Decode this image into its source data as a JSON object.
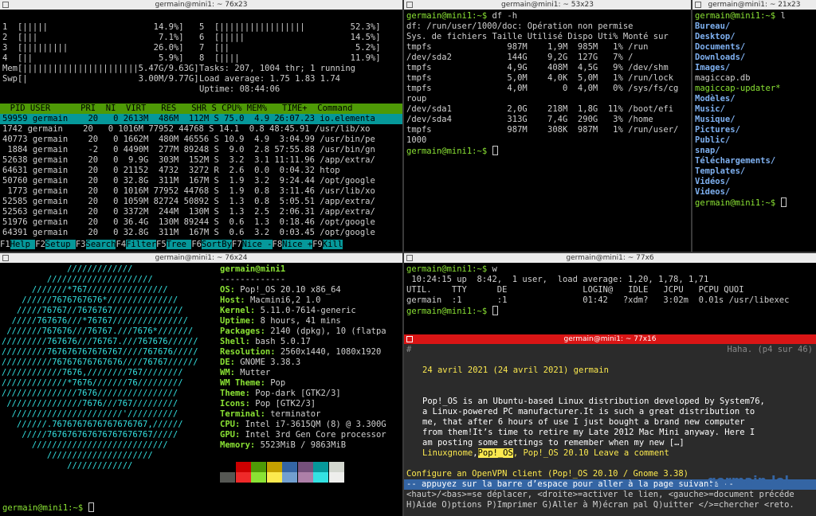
{
  "htop": {
    "title": "germain@mini1: ~ 76x23",
    "cpu": [
      "1  [|||||                     14.9%]",
      "2  [|||                        7.1%]",
      "3  [|||||||||                 26.0%]",
      "4  [||                         5.9%]"
    ],
    "cpu2": [
      "5  [|||||||||||||||||         52.3%]",
      "6  [|||||                     14.5%]",
      "7  [||                         5.2%]",
      "8  [||||                      11.9%]"
    ],
    "mem": "Mem[|||||||||||||||||||||||5.47G/9.63G]",
    "swp": "Swp[|                      3.00M/9.77G]",
    "tasks": "Tasks: 207, 1004 thr; 1 running",
    "load": "Load average: 1.75 1.83 1.74",
    "uptime": "Uptime: 08:44:06",
    "header": "  PID USER      PRI  NI  VIRT   RES   SHR S CPU% MEM%   TIME+  Command",
    "rows": [
      "59959 germain    20   0 2613M  486M  112M S 75.0  4.9 26:07.23 io.elementa",
      "1742 germain    20   0 1016M 77952 44768 S 14.1  0.8 48:45.91 /usr/lib/xo",
      "40773 germain    20   0 1662M  480M 46556 S 10.9  4.9  3:04.99 /usr/bin/pe",
      " 1884 germain    -2   0 4490M  277M 89248 S  9.0  2.8 57:55.88 /usr/bin/gn",
      "52638 germain    20   0  9.9G  303M  152M S  3.2  3.1 11:11.96 /app/extra/",
      "64631 germain    20   0 21152  4732  3272 R  2.6  0.0  0:04.32 htop",
      "50760 germain    20   0 32.8G  311M  167M S  1.9  3.2  9:24.44 /opt/google",
      " 1773 germain    20   0 1016M 77952 44768 S  1.9  0.8  3:11.46 /usr/lib/xo",
      "52585 germain    20   0 1059M 82724 50892 S  1.3  0.8  5:05.51 /app/extra/",
      "52563 germain    20   0 3372M  244M  130M S  1.3  2.5  2:06.31 /app/extra/",
      "51976 germain    20   0 36.4G  130M 89244 S  0.6  1.3  0:18.46 /opt/google",
      "64391 germain    20   0 32.8G  311M  167M S  0.6  3.2  0:03.45 /opt/google"
    ],
    "fkeys": [
      [
        "F1",
        "Help  "
      ],
      [
        "F2",
        "Setup "
      ],
      [
        "F3",
        "Search"
      ],
      [
        "F4",
        "Filter"
      ],
      [
        "F5",
        "Tree  "
      ],
      [
        "F6",
        "SortBy"
      ],
      [
        "F7",
        "Nice -"
      ],
      [
        "F8",
        "Nice +"
      ],
      [
        "F9",
        "Kill"
      ]
    ]
  },
  "df": {
    "title": "germain@mini1: ~ 53x23",
    "lines": [
      "germain@mini1:~$ df -h",
      "df: /run/user/1000/doc: Opération non permise",
      "Sys. de fichiers Taille Utilisé Dispo Uti% Monté sur",
      "tmpfs               987M    1,9M  985M   1% /run",
      "/dev/sda2           144G    9,2G  127G   7% /",
      "tmpfs               4,9G    408M  4,5G   9% /dev/shm",
      "tmpfs               5,0M    4,0K  5,0M   1% /run/lock",
      "tmpfs               4,0M       0  4,0M   0% /sys/fs/cg",
      "roup",
      "/dev/sda1           2,0G    218M  1,8G  11% /boot/efi",
      "/dev/sda4           313G    7,4G  290G   3% /home",
      "tmpfs               987M    308K  987M   1% /run/user/",
      "1000"
    ],
    "prompt": "germain@mini1:~$ "
  },
  "ls": {
    "title": "germain@mini1: ~ 21x23",
    "cmd": "germain@mini1:~$ l",
    "items": [
      [
        "Bureau/",
        "d"
      ],
      [
        "Desktop/",
        "d"
      ],
      [
        "Documents/",
        "d"
      ],
      [
        "Downloads/",
        "d"
      ],
      [
        "Images/",
        "d"
      ],
      [
        "magiccap.db",
        "f"
      ],
      [
        "magiccap-updater*",
        "x"
      ],
      [
        "Modèles/",
        "d"
      ],
      [
        "Music/",
        "d"
      ],
      [
        "Musique/",
        "d"
      ],
      [
        "Pictures/",
        "d"
      ],
      [
        "Public/",
        "d"
      ],
      [
        "snap/",
        "d"
      ],
      [
        "Téléchargements/",
        "d"
      ],
      [
        "Templates/",
        "d"
      ],
      [
        "Vidéos/",
        "d"
      ],
      [
        "Videos/",
        "d"
      ]
    ],
    "prompt": "germain@mini1:~$ "
  },
  "neo": {
    "title": "germain@mini1: ~ 76x24",
    "art": [
      "             /////////////",
      "         /////////////////////",
      "      ///////*767////////////////",
      "    //////7676767676*//////////////",
      "   /////76767//7676767//////////////",
      "  /////767676///*76767///////////////",
      " ///////767676///76767.///7676*///////",
      "/////////767676///76767.///767676//////",
      "/////////767676767676767////767676/////",
      "//////////76767676767676////76767//////",
      "////////////7676,////////767////////",
      "/////////////*7676///////76/////////",
      "///////////////7676////////////////",
      " ///////////////7676///767/////////",
      "  //////////////////////'//////////",
      "   //////.7676767676767676767,//////",
      "    /////767676767676767676767/////",
      "      ///////////////////////////",
      "         /////////////////////",
      "             /////////////"
    ],
    "user": "germain@mini1",
    "dash": "-------------",
    "info": [
      [
        "OS",
        "Pop!_OS 20.10 x86_64"
      ],
      [
        "Host",
        "Macmini6,2 1.0"
      ],
      [
        "Kernel",
        "5.11.0-7614-generic"
      ],
      [
        "Uptime",
        "8 hours, 41 mins"
      ],
      [
        "Packages",
        "2140 (dpkg), 10 (flatpa"
      ],
      [
        "Shell",
        "bash 5.0.17"
      ],
      [
        "Resolution",
        "2560x1440, 1080x1920"
      ],
      [
        "DE",
        "GNOME 3.38.3"
      ],
      [
        "WM",
        "Mutter"
      ],
      [
        "WM Theme",
        "Pop"
      ],
      [
        "Theme",
        "Pop-dark [GTK2/3]"
      ],
      [
        "Icons",
        "Pop [GTK2/3]"
      ],
      [
        "Terminal",
        "terminator"
      ],
      [
        "CPU",
        "Intel i7-3615QM (8) @ 3.300G"
      ],
      [
        "GPU",
        "Intel 3rd Gen Core processor"
      ],
      [
        "Memory",
        "5523MiB / 9863MiB"
      ]
    ],
    "swatches": [
      "#000000",
      "#cc0000",
      "#4e9a06",
      "#c4a000",
      "#3465a4",
      "#75507b",
      "#06989a",
      "#d3d7cf"
    ],
    "swatches2": [
      "#555753",
      "#ef2929",
      "#8ae234",
      "#fce94f",
      "#729fcf",
      "#ad7fa8",
      "#34e2e2",
      "#eeeeec"
    ],
    "prompt": "germain@mini1:~$ "
  },
  "w": {
    "title": "germain@mini1: ~ 77x6",
    "lines": [
      "germain@mini1:~$ w",
      " 10:24:15 up  8:42,  1 user,  load average: 1,20, 1,78, 1,71",
      "UTIL.    TTY      DE               LOGIN@   IDLE   JCPU   PCPU QUOI",
      "germain  :1       :1               01:42   ?xdm?   3:02m  0.01s /usr/libexec"
    ],
    "prompt": "germain@mini1:~$ "
  },
  "lynx": {
    "title": "germain@mini1: ~ 77x16",
    "hash": "#",
    "page": "Haha. (p4 sur 46)",
    "date": "24 avril 2021 (24 avril 2021) germain",
    "para": [
      "Pop!_OS is an Ubuntu-based Linux distribution developed by System76,",
      "a Linux-powered PC manufacturer.It is such a great distribution to",
      "me, that after 6 hours of use I just bought a brand new computer",
      "from them!It’s time to retire my Late 2012 Mac Mini anyway. Here I",
      "am posting some settings to remember when my new […]"
    ],
    "links_a": "Linuxgnome",
    "links_b": "Pop!_OS",
    "links_c": ", Pop!_OS 20.10 Leave a comment",
    "next": "Configure an OpenVPN client (Pop!_OS 20.10 / Gnome 3.38)",
    "status": "-- appuyez sur la barre d’espace pour aller à la page suivante --",
    "help1": "<haut>/<bas>=se déplacer, <droite>=activer le lien, <gauche>=document précéde",
    "help2": "H)Aide O)ptions P)Imprimer G)Aller à M)écran pal Q)uitter </>=chercher <reto.",
    "watermark": "germain.lol"
  }
}
